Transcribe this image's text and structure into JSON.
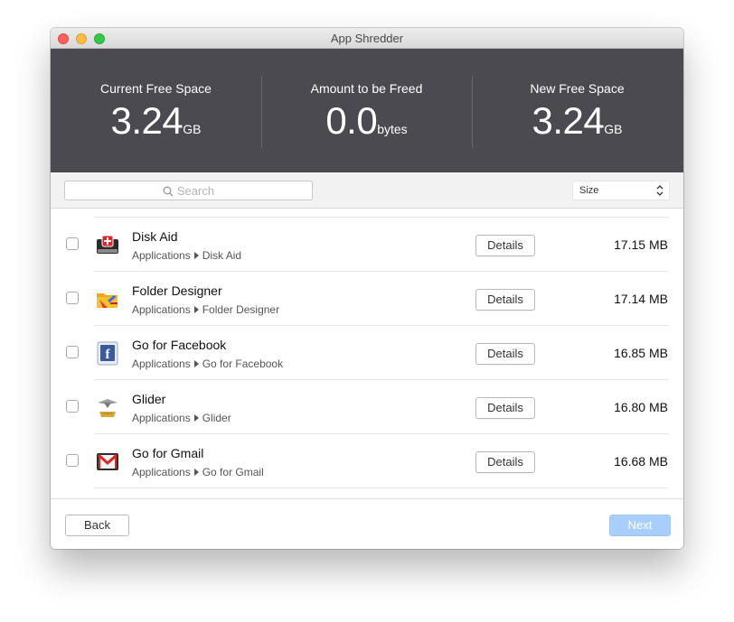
{
  "window": {
    "title": "App Shredder"
  },
  "stats": [
    {
      "label": "Current Free Space",
      "value": "3.24",
      "unit": "GB"
    },
    {
      "label": "Amount to be Freed",
      "value": "0.0",
      "unit": "bytes"
    },
    {
      "label": "New Free Space",
      "value": "3.24",
      "unit": "GB"
    }
  ],
  "search": {
    "placeholder": "Search"
  },
  "sort": {
    "selected": "Size"
  },
  "apps": [
    {
      "name": "Disk Aid",
      "path_root": "Applications",
      "path_item": "Disk Aid",
      "details_label": "Details",
      "size": "17.15 MB",
      "icon": "disk-aid-icon"
    },
    {
      "name": "Folder Designer",
      "path_root": "Applications",
      "path_item": "Folder Designer",
      "details_label": "Details",
      "size": "17.14 MB",
      "icon": "folder-designer-icon"
    },
    {
      "name": "Go for Facebook",
      "path_root": "Applications",
      "path_item": "Go for Facebook",
      "details_label": "Details",
      "size": "16.85 MB",
      "icon": "facebook-icon"
    },
    {
      "name": "Glider",
      "path_root": "Applications",
      "path_item": "Glider",
      "details_label": "Details",
      "size": "16.80 MB",
      "icon": "glider-icon"
    },
    {
      "name": "Go for Gmail",
      "path_root": "Applications",
      "path_item": "Go for Gmail",
      "details_label": "Details",
      "size": "16.68 MB",
      "icon": "gmail-icon"
    }
  ],
  "footer": {
    "back_label": "Back",
    "next_label": "Next"
  },
  "colors": {
    "header_bg": "#4b4a51",
    "next_button": "#a8cffc"
  }
}
